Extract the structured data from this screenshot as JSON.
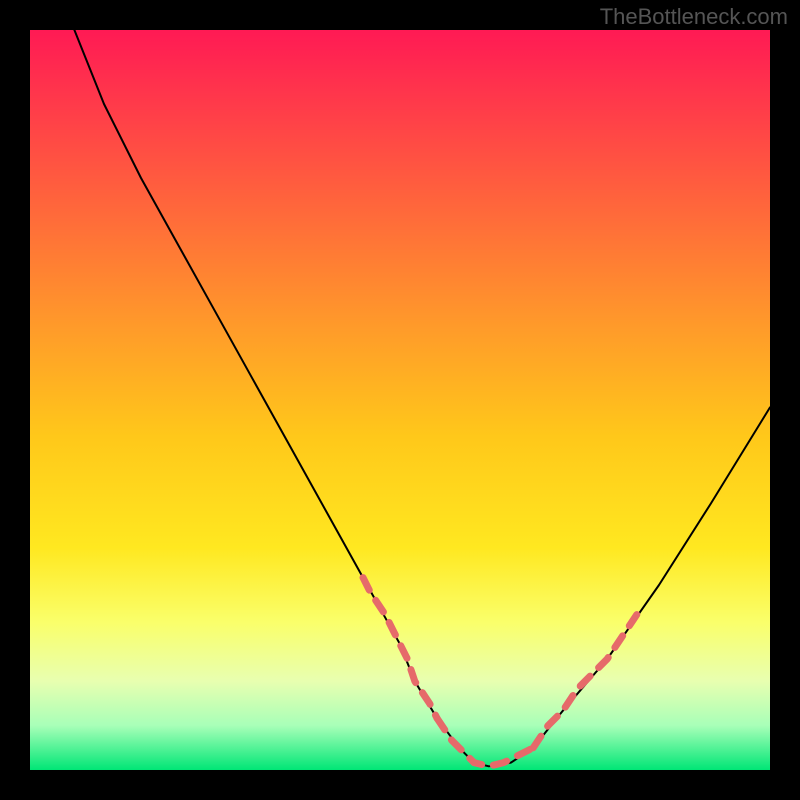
{
  "watermark": "TheBottleneck.com",
  "chart_data": {
    "type": "line",
    "title": "",
    "xlabel": "",
    "ylabel": "",
    "xlim": [
      0,
      100
    ],
    "ylim": [
      0,
      100
    ],
    "grid": false,
    "legend": false,
    "series": [
      {
        "name": "bottleneck-curve",
        "x": [
          6,
          10,
          15,
          20,
          25,
          30,
          35,
          40,
          45,
          50,
          52,
          55,
          58,
          60,
          62,
          65,
          68,
          72,
          78,
          85,
          92,
          100
        ],
        "y": [
          100,
          90,
          80,
          71,
          62,
          53,
          44,
          35,
          26,
          17,
          12,
          7,
          3,
          1,
          0.5,
          1,
          3,
          8,
          15,
          25,
          36,
          49
        ],
        "color": "#000000",
        "width": 2
      },
      {
        "name": "highlight-left",
        "x": [
          45,
          46,
          48,
          49,
          51,
          52,
          54,
          55
        ],
        "y": [
          26,
          24,
          21,
          19,
          15,
          12,
          9,
          7
        ],
        "color": "#e66a6a",
        "width": 7,
        "dashed": true
      },
      {
        "name": "highlight-bottom",
        "x": [
          55,
          57,
          59,
          60,
          62,
          64,
          66,
          68
        ],
        "y": [
          7,
          4,
          2,
          1,
          0.5,
          1,
          2,
          3
        ],
        "color": "#e66a6a",
        "width": 7,
        "dashed": true
      },
      {
        "name": "highlight-right",
        "x": [
          68,
          70,
          72,
          74,
          76,
          78,
          80,
          82
        ],
        "y": [
          3,
          6,
          8,
          11,
          13,
          15,
          18,
          21
        ],
        "color": "#e66a6a",
        "width": 7,
        "dashed": true
      }
    ]
  }
}
